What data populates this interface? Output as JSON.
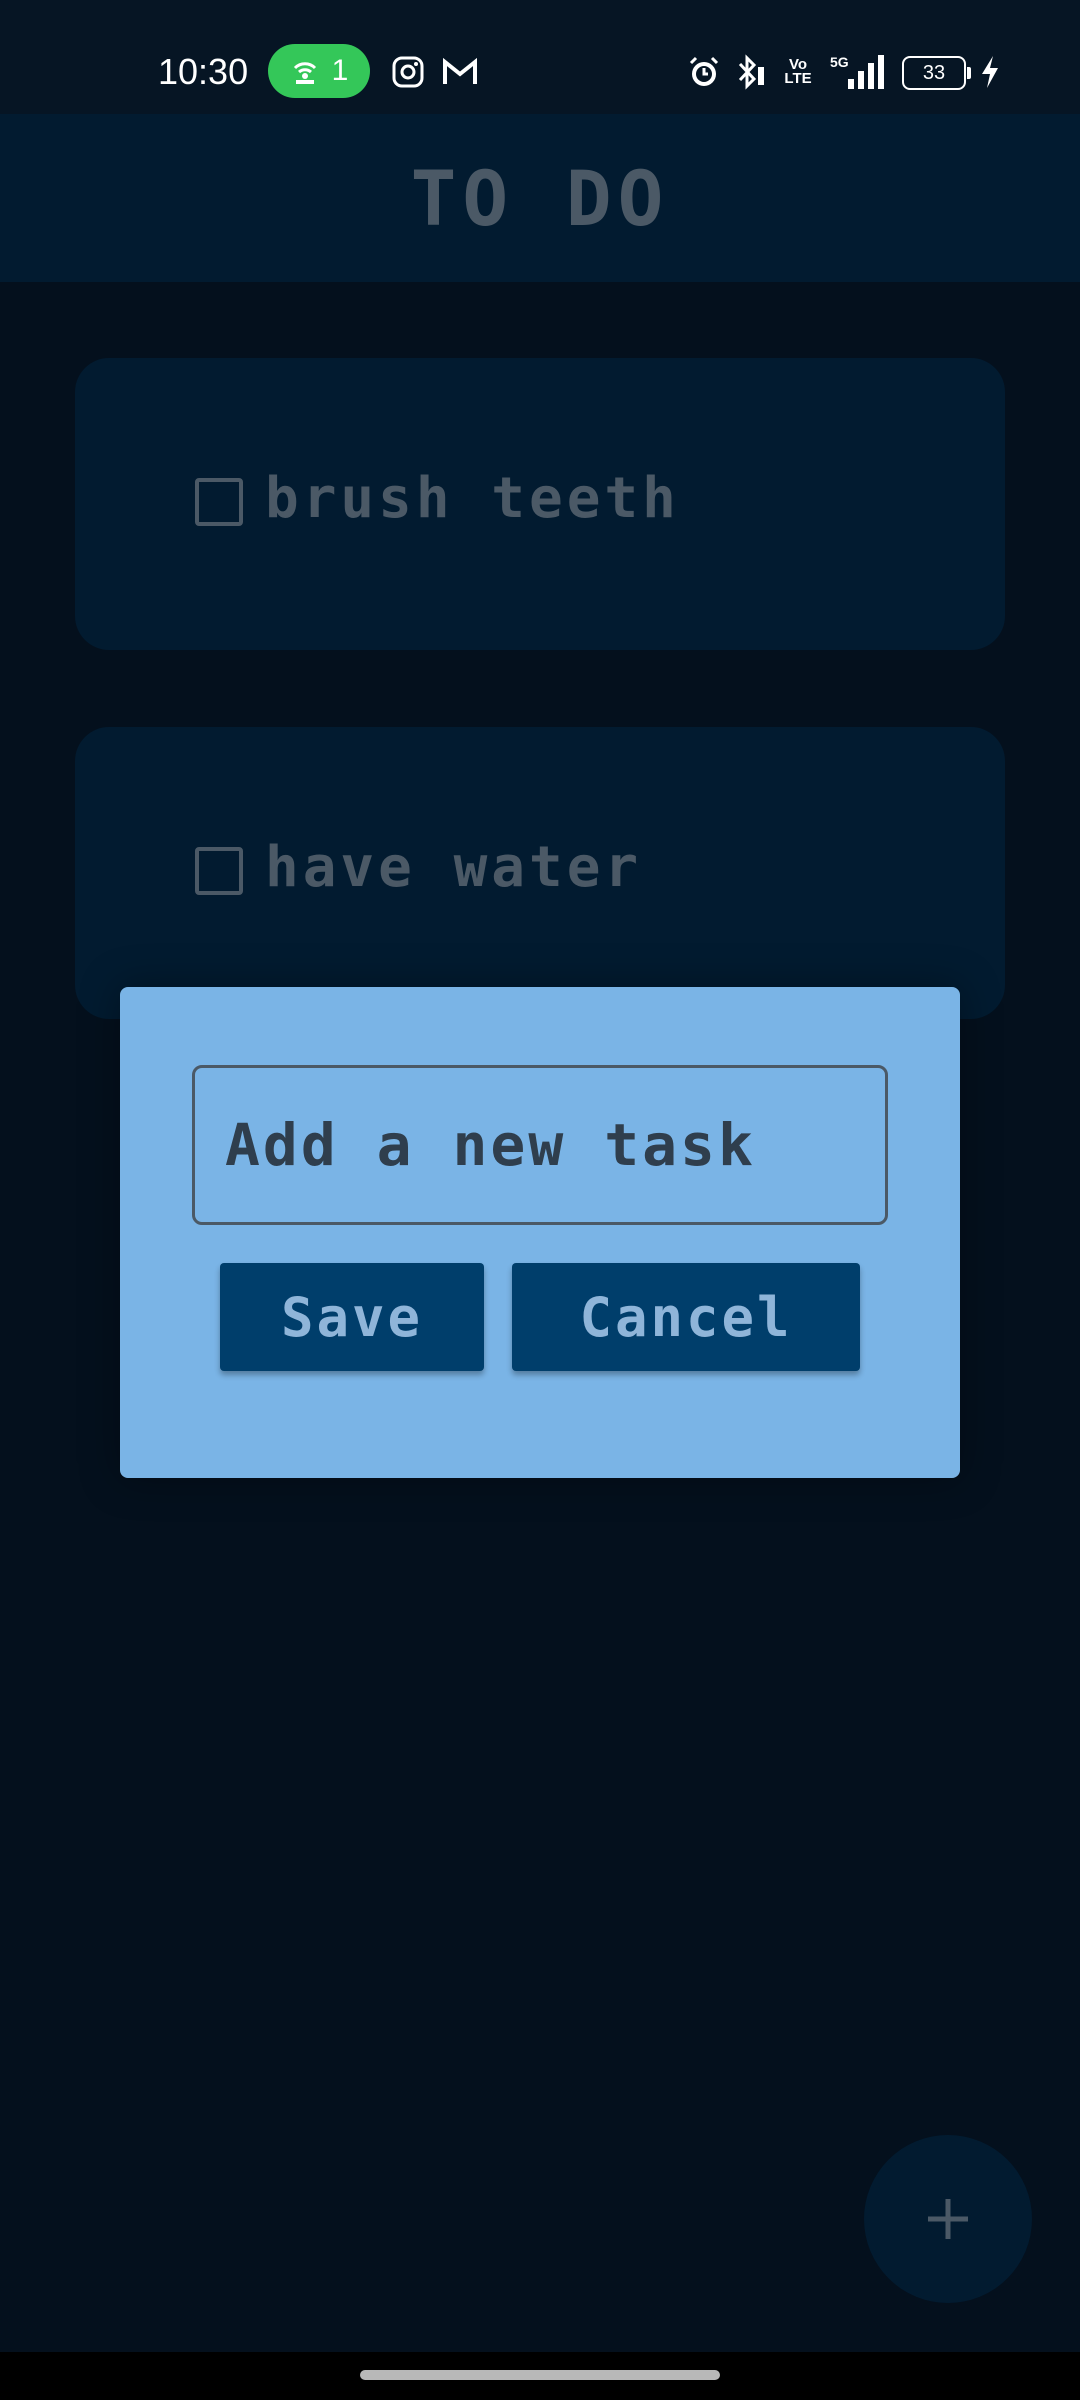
{
  "status_bar": {
    "time": "10:30",
    "hotspot_count": "1",
    "battery": "33",
    "icons": [
      "instagram-icon",
      "gmail-icon",
      "alarm-icon",
      "bluetooth-icon",
      "volte-icon",
      "5g-signal-icon",
      "charging-icon"
    ]
  },
  "header": {
    "title": "TO DO"
  },
  "tasks": [
    {
      "label": "brush teeth",
      "checked": false
    },
    {
      "label": "have water",
      "checked": false
    }
  ],
  "dialog": {
    "input_placeholder": "Add a new task",
    "input_value": "",
    "save_label": "Save",
    "cancel_label": "Cancel"
  },
  "fab": {
    "icon": "plus-icon"
  },
  "colors": {
    "background": "#04101d",
    "card": "#021b30",
    "dialog": "#7ab4e6",
    "button": "#003e6b",
    "muted_text": "#4b5966"
  }
}
